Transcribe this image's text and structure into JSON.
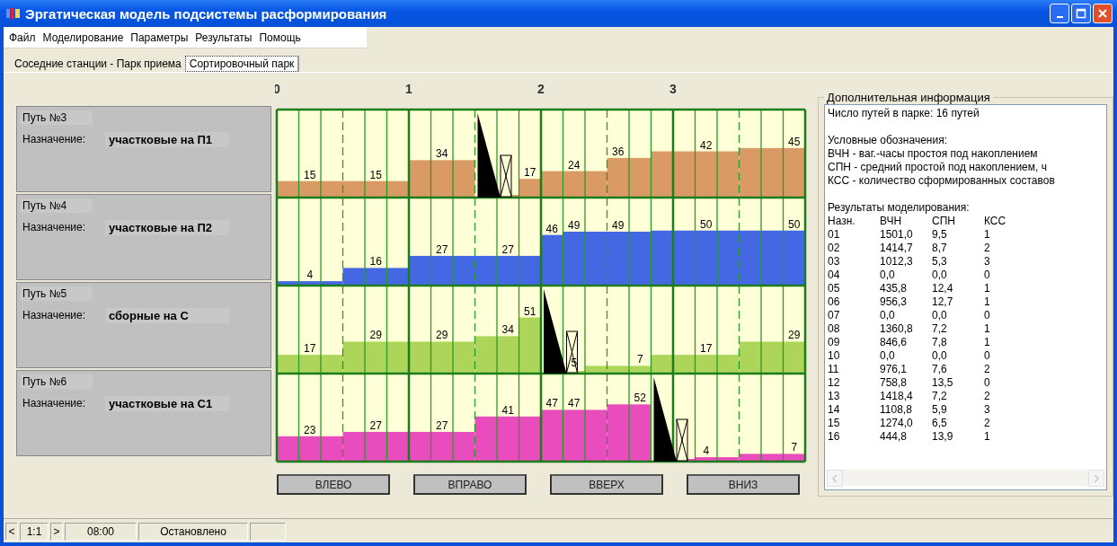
{
  "window": {
    "title": "Эргатическая модель подсистемы расформирования"
  },
  "menu": [
    {
      "label": "Файл"
    },
    {
      "label": "Моделирование"
    },
    {
      "label": "Параметры"
    },
    {
      "label": "Результаты"
    },
    {
      "label": "Помощь"
    }
  ],
  "tabs": [
    {
      "label": "Соседние станции - Парк приема",
      "selected": false
    },
    {
      "label": "Сортировочный парк",
      "selected": true
    }
  ],
  "axis": [
    "0",
    "1",
    "2",
    "3"
  ],
  "tracks": [
    {
      "title": "Путь №3",
      "purpose_label": "Назначение:",
      "purpose": "участковые на П1",
      "color": "#d99a66",
      "segments": [
        {
          "kind": "bar",
          "cells": [
            {
              "kind": "empty"
            },
            {
              "kind": "count",
              "label": "15"
            },
            {
              "kind": "empty"
            },
            {
              "kind": "empty"
            },
            {
              "kind": "count",
              "label": "15"
            },
            {
              "kind": "empty"
            }
          ]
        },
        {
          "kind": "bar",
          "cells": [
            {
              "kind": "empty"
            },
            {
              "kind": "count",
              "label": "34"
            },
            {
              "kind": "empty"
            }
          ]
        },
        {
          "kind": "engine",
          "cells": [
            {
              "kind": "empty"
            }
          ]
        },
        {
          "kind": "wagon",
          "cells": [
            {
              "kind": "empty"
            }
          ]
        },
        {
          "kind": "bar",
          "cells": [
            {
              "kind": "count",
              "label": "17"
            }
          ]
        },
        {
          "kind": "bar",
          "cells": [
            {
              "kind": "empty"
            },
            {
              "kind": "count",
              "label": "24"
            },
            {
              "kind": "empty"
            }
          ]
        },
        {
          "kind": "bar",
          "cells": [
            {
              "kind": "count",
              "label": "36"
            },
            {
              "kind": "empty"
            }
          ]
        },
        {
          "kind": "bar",
          "cells": [
            {
              "kind": "empty"
            },
            {
              "kind": "empty"
            },
            {
              "kind": "count",
              "label": "42"
            },
            {
              "kind": "empty"
            }
          ]
        },
        {
          "kind": "bar",
          "cells": [
            {
              "kind": "empty"
            },
            {
              "kind": "empty"
            },
            {
              "kind": "count",
              "label": "45"
            }
          ]
        }
      ]
    },
    {
      "title": "Путь №4",
      "purpose_label": "Назначение:",
      "purpose": "участковые на П2",
      "color": "#4468e4",
      "segments": [
        {
          "kind": "bar",
          "cells": [
            {
              "kind": "empty"
            },
            {
              "kind": "count",
              "label": "4"
            },
            {
              "kind": "empty"
            }
          ]
        },
        {
          "kind": "bar",
          "cells": [
            {
              "kind": "empty"
            },
            {
              "kind": "count",
              "label": "16"
            },
            {
              "kind": "empty"
            }
          ]
        },
        {
          "kind": "bar",
          "cells": [
            {
              "kind": "empty"
            },
            {
              "kind": "count",
              "label": "27"
            },
            {
              "kind": "empty"
            },
            {
              "kind": "empty"
            },
            {
              "kind": "count",
              "label": "27"
            },
            {
              "kind": "empty"
            }
          ]
        },
        {
          "kind": "bar",
          "cells": [
            {
              "kind": "count",
              "label": "46"
            }
          ]
        },
        {
          "kind": "bar",
          "cells": [
            {
              "kind": "count",
              "label": "49"
            },
            {
              "kind": "empty"
            },
            {
              "kind": "count",
              "label": "49"
            },
            {
              "kind": "empty"
            }
          ]
        },
        {
          "kind": "bar",
          "cells": [
            {
              "kind": "empty"
            },
            {
              "kind": "empty"
            },
            {
              "kind": "count",
              "label": "50"
            },
            {
              "kind": "empty"
            },
            {
              "kind": "empty"
            },
            {
              "kind": "empty"
            },
            {
              "kind": "count",
              "label": "50"
            }
          ]
        }
      ]
    },
    {
      "title": "Путь №5",
      "purpose_label": "Назначение:",
      "purpose": "сборные на С",
      "color": "#acd55a",
      "segments": [
        {
          "kind": "bar",
          "cells": [
            {
              "kind": "empty"
            },
            {
              "kind": "count",
              "label": "17"
            },
            {
              "kind": "empty"
            }
          ]
        },
        {
          "kind": "bar",
          "cells": [
            {
              "kind": "empty"
            },
            {
              "kind": "count",
              "label": "29"
            },
            {
              "kind": "empty"
            },
            {
              "kind": "empty"
            },
            {
              "kind": "count",
              "label": "29"
            },
            {
              "kind": "empty"
            }
          ]
        },
        {
          "kind": "bar",
          "cells": [
            {
              "kind": "empty"
            },
            {
              "kind": "count",
              "label": "34"
            }
          ]
        },
        {
          "kind": "bar",
          "cells": [
            {
              "kind": "count",
              "label": "51"
            }
          ]
        },
        {
          "kind": "engine",
          "cells": [
            {
              "kind": "empty"
            }
          ]
        },
        {
          "kind": "wagon",
          "cells": [
            {
              "kind": "count",
              "label": "5"
            }
          ]
        },
        {
          "kind": "bar",
          "cells": [
            {
              "kind": "empty"
            },
            {
              "kind": "empty"
            },
            {
              "kind": "count",
              "label": "7"
            }
          ]
        },
        {
          "kind": "bar",
          "cells": [
            {
              "kind": "empty"
            },
            {
              "kind": "empty"
            },
            {
              "kind": "count",
              "label": "17"
            },
            {
              "kind": "empty"
            }
          ]
        },
        {
          "kind": "bar",
          "cells": [
            {
              "kind": "empty"
            },
            {
              "kind": "empty"
            },
            {
              "kind": "count",
              "label": "29"
            }
          ]
        }
      ]
    },
    {
      "title": "Путь №6",
      "purpose_label": "Назначение:",
      "purpose": "участковые на С1",
      "color": "#e84cbd",
      "segments": [
        {
          "kind": "bar",
          "cells": [
            {
              "kind": "empty"
            },
            {
              "kind": "count",
              "label": "23"
            },
            {
              "kind": "empty"
            }
          ]
        },
        {
          "kind": "bar",
          "cells": [
            {
              "kind": "empty"
            },
            {
              "kind": "count",
              "label": "27"
            },
            {
              "kind": "empty"
            },
            {
              "kind": "empty"
            },
            {
              "kind": "count",
              "label": "27"
            },
            {
              "kind": "empty"
            }
          ]
        },
        {
          "kind": "bar",
          "cells": [
            {
              "kind": "empty"
            },
            {
              "kind": "count",
              "label": "41"
            },
            {
              "kind": "empty"
            }
          ]
        },
        {
          "kind": "bar",
          "cells": [
            {
              "kind": "count",
              "label": "47"
            },
            {
              "kind": "count",
              "label": "47"
            },
            {
              "kind": "empty"
            }
          ]
        },
        {
          "kind": "bar",
          "cells": [
            {
              "kind": "empty"
            },
            {
              "kind": "count",
              "label": "52"
            }
          ]
        },
        {
          "kind": "engine",
          "cells": [
            {
              "kind": "empty"
            }
          ]
        },
        {
          "kind": "wagon",
          "cells": [
            {
              "kind": "empty"
            }
          ]
        },
        {
          "kind": "bar",
          "cells": [
            {
              "kind": "count",
              "label": "4"
            },
            {
              "kind": "empty"
            }
          ]
        },
        {
          "kind": "bar",
          "cells": [
            {
              "kind": "empty"
            },
            {
              "kind": "empty"
            },
            {
              "kind": "count",
              "label": "7"
            }
          ]
        }
      ]
    }
  ],
  "buttons": [
    "ВЛЕВО",
    "ВПРАВО",
    "ВВЕРХ",
    "ВНИЗ"
  ],
  "info": {
    "title": "Дополнительная информация",
    "count": "Число путей в парке:  16 путей",
    "legend_title": "Условные обозначения:",
    "legend": [
      "ВЧН - ваг.-часы простоя под накоплением",
      "СПН - средний простой под накоплением, ч",
      "КСС - количество сформированных составов"
    ],
    "results_title": "Результаты моделирования:",
    "columns": [
      "Назн.",
      "ВЧН",
      "СПН",
      "КСС"
    ],
    "rows": [
      [
        "01",
        "1501,0",
        "9,5",
        "1"
      ],
      [
        "02",
        "1414,7",
        "8,7",
        "2"
      ],
      [
        "03",
        "1012,3",
        "5,3",
        "3"
      ],
      [
        "04",
        "0,0",
        "0,0",
        "0"
      ],
      [
        "05",
        "435,8",
        "12,4",
        "1"
      ],
      [
        "06",
        "956,3",
        "12,7",
        "1"
      ],
      [
        "07",
        "0,0",
        "0,0",
        "0"
      ],
      [
        "08",
        "1360,8",
        "7,2",
        "1"
      ],
      [
        "09",
        "846,6",
        "7,8",
        "1"
      ],
      [
        "10",
        "0,0",
        "0,0",
        "0"
      ],
      [
        "11",
        "976,1",
        "7,6",
        "2"
      ],
      [
        "12",
        "758,8",
        "13,5",
        "0"
      ],
      [
        "13",
        "1418,4",
        "7,2",
        "2"
      ],
      [
        "14",
        "1108,8",
        "5,9",
        "3"
      ],
      [
        "15",
        "1274,0",
        "6,5",
        "2"
      ],
      [
        "16",
        "444,8",
        "13,9",
        "1"
      ]
    ]
  },
  "status": {
    "prev": "<",
    "scale": "1:1",
    "next": ">",
    "time": "08:00",
    "state": "Остановлено"
  }
}
